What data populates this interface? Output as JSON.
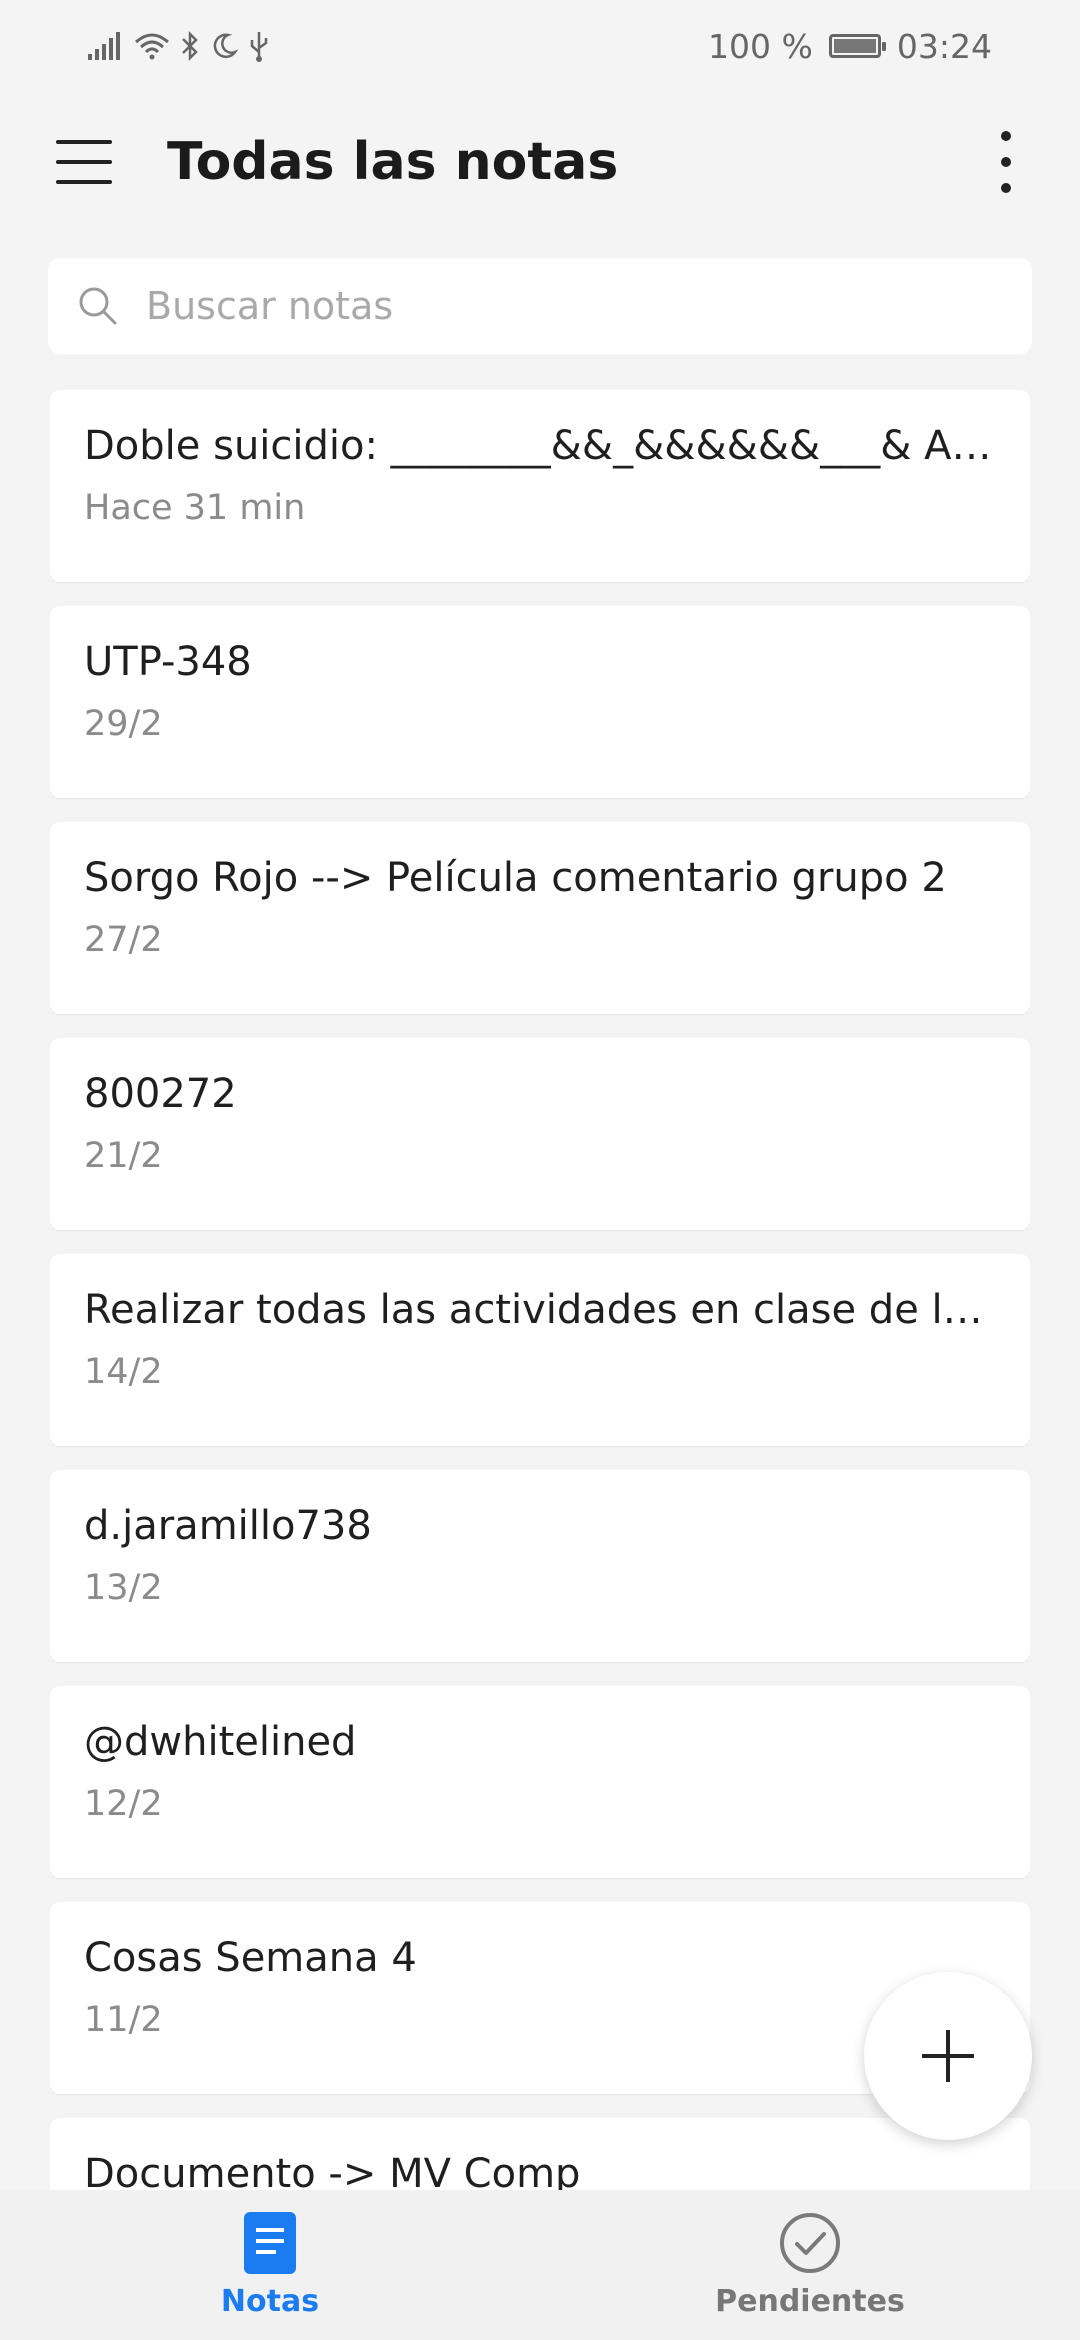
{
  "status_bar": {
    "battery_text": "100 %",
    "time": "03:24"
  },
  "app_bar": {
    "title": "Todas las notas"
  },
  "search": {
    "placeholder": "Buscar notas"
  },
  "notes": [
    {
      "title": "Doble suicidio: ________&&_&&&&&&___& Amor en secreto",
      "date": "Hace 31 min"
    },
    {
      "title": "UTP-348",
      "date": "29/2"
    },
    {
      "title": "Sorgo Rojo --> Película comentario grupo 2",
      "date": "27/2"
    },
    {
      "title": "800272",
      "date": "21/2"
    },
    {
      "title": "Realizar todas las actividades en clase de la semana",
      "date": "14/2"
    },
    {
      "title": "d.jaramillo738",
      "date": "13/2"
    },
    {
      "title": "@dwhitelined",
      "date": "12/2"
    },
    {
      "title": "Cosas Semana 4",
      "date": "11/2"
    },
    {
      "title": "Documento -> MV Comp",
      "date": ""
    }
  ],
  "bottom_nav": {
    "notes_label": "Notas",
    "todo_label": "Pendientes"
  },
  "colors": {
    "accent": "#1a7cf0",
    "background": "#f4f4f4"
  }
}
